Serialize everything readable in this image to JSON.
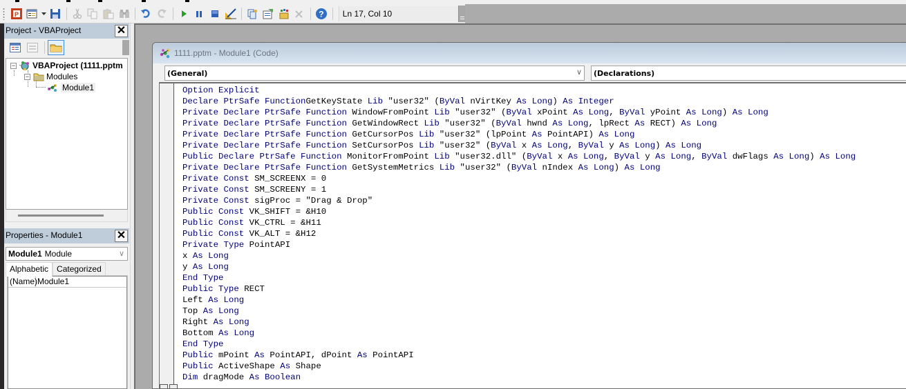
{
  "toolbar": {
    "buttons": [
      {
        "name": "view-powerpoint",
        "icon": "powerpoint-icon"
      },
      {
        "name": "insert-module",
        "icon": "insert-module-icon"
      },
      {
        "name": "insert-dropdown",
        "icon": "dropdown-arrow-icon"
      },
      {
        "name": "save",
        "icon": "save-icon"
      },
      {
        "name": "cut",
        "icon": "scissors-icon"
      },
      {
        "name": "copy",
        "icon": "copy-icon"
      },
      {
        "name": "paste",
        "icon": "paste-icon"
      },
      {
        "name": "find",
        "icon": "binoculars-icon"
      },
      {
        "name": "undo",
        "icon": "undo-icon"
      },
      {
        "name": "redo",
        "icon": "redo-icon"
      },
      {
        "name": "run",
        "icon": "play-icon"
      },
      {
        "name": "break",
        "icon": "pause-icon"
      },
      {
        "name": "reset",
        "icon": "stop-icon"
      },
      {
        "name": "design-mode",
        "icon": "design-mode-icon"
      },
      {
        "name": "project-explorer",
        "icon": "project-explorer-icon"
      },
      {
        "name": "properties-window",
        "icon": "properties-icon"
      },
      {
        "name": "object-browser",
        "icon": "object-browser-icon"
      },
      {
        "name": "toolbox",
        "icon": "toolbox-icon"
      },
      {
        "name": "help",
        "icon": "help-icon"
      }
    ],
    "status": "Ln 17, Col 10"
  },
  "project_panel": {
    "title": "Project - VBAProject",
    "close_label": "✕",
    "tools": [
      "view-code",
      "view-object",
      "toggle-folders"
    ],
    "tree": [
      {
        "label": "VBAProject (1111.pptm",
        "level": 0,
        "expander": "−",
        "icon": "vba-project-icon",
        "bold": true
      },
      {
        "label": "Modules",
        "level": 1,
        "expander": "−",
        "icon": "folder-icon",
        "bold": false
      },
      {
        "label": "Module1",
        "level": 2,
        "expander": null,
        "icon": "module-icon",
        "bold": false,
        "selected": true
      }
    ]
  },
  "properties_panel": {
    "title": "Properties - Module1",
    "close_label": "✕",
    "object_name": "Module1",
    "object_type": "Module",
    "tabs": [
      {
        "label": "Alphabetic",
        "active": true
      },
      {
        "label": "Categorized",
        "active": false
      }
    ],
    "rows": [
      {
        "key": "(Name)",
        "value": "Module1"
      }
    ]
  },
  "code_window": {
    "title": "1111.pptm - Module1 (Code)",
    "object_combo": "(General)",
    "procedure_combo": "(Declarations)",
    "keyword_color": "#00007F",
    "lines": [
      [
        [
          "kw",
          "Option Explicit"
        ]
      ],
      [
        [
          "kw",
          "Declare PtrSafe Function"
        ],
        [
          "",
          "GetKeyState "
        ],
        [
          "kw",
          "Lib"
        ],
        [
          "",
          " \"user32\" ("
        ],
        [
          "kw",
          "ByVal"
        ],
        [
          "",
          " nVirtKey "
        ],
        [
          "kw",
          "As Long"
        ],
        [
          "",
          ") "
        ],
        [
          "kw",
          "As Integer"
        ]
      ],
      [
        [
          "kw",
          "Private Declare PtrSafe Function"
        ],
        [
          "",
          " WindowFromPoint "
        ],
        [
          "kw",
          "Lib"
        ],
        [
          "",
          " \"user32\" ("
        ],
        [
          "kw",
          "ByVal"
        ],
        [
          "",
          " xPoint "
        ],
        [
          "kw",
          "As Long"
        ],
        [
          ", "
        ],
        [
          "kw",
          "ByVal"
        ],
        [
          "",
          " yPoint "
        ],
        [
          "kw",
          "As Long"
        ],
        [
          "",
          ") "
        ],
        [
          "kw",
          "As Long"
        ]
      ],
      [
        [
          "kw",
          "Private Declare PtrSafe Function"
        ],
        [
          "",
          " GetWindowRect "
        ],
        [
          "kw",
          "Lib"
        ],
        [
          "",
          " \"user32\" ("
        ],
        [
          "kw",
          "ByVal"
        ],
        [
          "",
          " hwnd "
        ],
        [
          "kw",
          "As Long"
        ],
        [
          "",
          ", lpRect "
        ],
        [
          "kw",
          "As"
        ],
        [
          "",
          " RECT) "
        ],
        [
          "kw",
          "As Long"
        ]
      ],
      [
        [
          "kw",
          "Private Declare PtrSafe Function"
        ],
        [
          "",
          " GetCursorPos "
        ],
        [
          "kw",
          "Lib"
        ],
        [
          "",
          " \"user32\" (lpPoint "
        ],
        [
          "kw",
          "As"
        ],
        [
          "",
          " PointAPI) "
        ],
        [
          "kw",
          "As Long"
        ]
      ],
      [
        [
          "kw",
          "Private Declare PtrSafe Function"
        ],
        [
          "",
          " SetCursorPos "
        ],
        [
          "kw",
          "Lib"
        ],
        [
          "",
          " \"user32\" ("
        ],
        [
          "kw",
          "ByVal"
        ],
        [
          "",
          " x "
        ],
        [
          "kw",
          "As Long"
        ],
        [
          "",
          ", "
        ],
        [
          "kw",
          "ByVal"
        ],
        [
          "",
          " y "
        ],
        [
          "kw",
          "As Long"
        ],
        [
          "",
          ") "
        ],
        [
          "kw",
          "As Long"
        ]
      ],
      [
        [
          "kw",
          "Public Declare PtrSafe Function"
        ],
        [
          "",
          " MonitorFromPoint "
        ],
        [
          "kw",
          "Lib"
        ],
        [
          "",
          " \"user32.dll\" ("
        ],
        [
          "kw",
          "ByVal"
        ],
        [
          "",
          " x "
        ],
        [
          "kw",
          "As Long"
        ],
        [
          "",
          ", "
        ],
        [
          "kw",
          "ByVal"
        ],
        [
          "",
          " y "
        ],
        [
          "kw",
          "As Long"
        ],
        [
          "",
          ", "
        ],
        [
          "kw",
          "ByVal"
        ],
        [
          "",
          " dwFlags "
        ],
        [
          "kw",
          "As Long"
        ],
        [
          "",
          ") "
        ],
        [
          "kw",
          "As Long"
        ]
      ],
      [
        [
          "kw",
          "Private Declare PtrSafe Function"
        ],
        [
          "",
          " GetSystemMetrics "
        ],
        [
          "kw",
          "Lib"
        ],
        [
          "",
          " \"user32\" ("
        ],
        [
          "kw",
          "ByVal"
        ],
        [
          "",
          " nIndex "
        ],
        [
          "kw",
          "As Long"
        ],
        [
          "",
          ") "
        ],
        [
          "kw",
          "As Long"
        ]
      ],
      [
        [
          "kw",
          "Private Const"
        ],
        [
          "",
          " SM_SCREENX = 0"
        ]
      ],
      [
        [
          "kw",
          "Private Const"
        ],
        [
          "",
          " SM_SCREENY = 1"
        ]
      ],
      [
        [
          "kw",
          "Private Const"
        ],
        [
          "",
          " sigProc = \"Drag & Drop\""
        ]
      ],
      [
        [
          "kw",
          "Public Const"
        ],
        [
          "",
          " VK_SHIFT = &H10"
        ]
      ],
      [
        [
          "kw",
          "Public Const"
        ],
        [
          "",
          " VK_CTRL = &H11"
        ]
      ],
      [
        [
          "kw",
          "Public Const"
        ],
        [
          "",
          " VK_ALT = &H12"
        ]
      ],
      [
        [
          "kw",
          "Private Type"
        ],
        [
          "",
          " PointAPI"
        ]
      ],
      [
        [
          "",
          "x "
        ],
        [
          "kw",
          "As Long"
        ]
      ],
      [
        [
          "",
          "y "
        ],
        [
          "kw",
          "As Long"
        ]
      ],
      [
        [
          "kw",
          "End Type"
        ]
      ],
      [
        [
          "kw",
          "Public Type"
        ],
        [
          "",
          " RECT"
        ]
      ],
      [
        [
          "",
          "Left "
        ],
        [
          "kw",
          "As Long"
        ]
      ],
      [
        [
          "",
          "Top "
        ],
        [
          "kw",
          "As Long"
        ]
      ],
      [
        [
          "",
          "Right "
        ],
        [
          "kw",
          "As Long"
        ]
      ],
      [
        [
          "",
          "Bottom "
        ],
        [
          "kw",
          "As Long"
        ]
      ],
      [
        [
          "kw",
          "End Type"
        ]
      ],
      [
        [
          "kw",
          "Public"
        ],
        [
          "",
          " mPoint "
        ],
        [
          "kw",
          "As"
        ],
        [
          "",
          " PointAPI, dPoint "
        ],
        [
          "kw",
          "As"
        ],
        [
          "",
          " PointAPI"
        ]
      ],
      [
        [
          "kw",
          "Public"
        ],
        [
          "",
          " ActiveShape "
        ],
        [
          "kw",
          "As"
        ],
        [
          "",
          " Shape"
        ]
      ],
      [
        [
          "kw",
          "Dim"
        ],
        [
          "",
          " dragMode "
        ],
        [
          "kw",
          "As Boolean"
        ]
      ]
    ]
  }
}
